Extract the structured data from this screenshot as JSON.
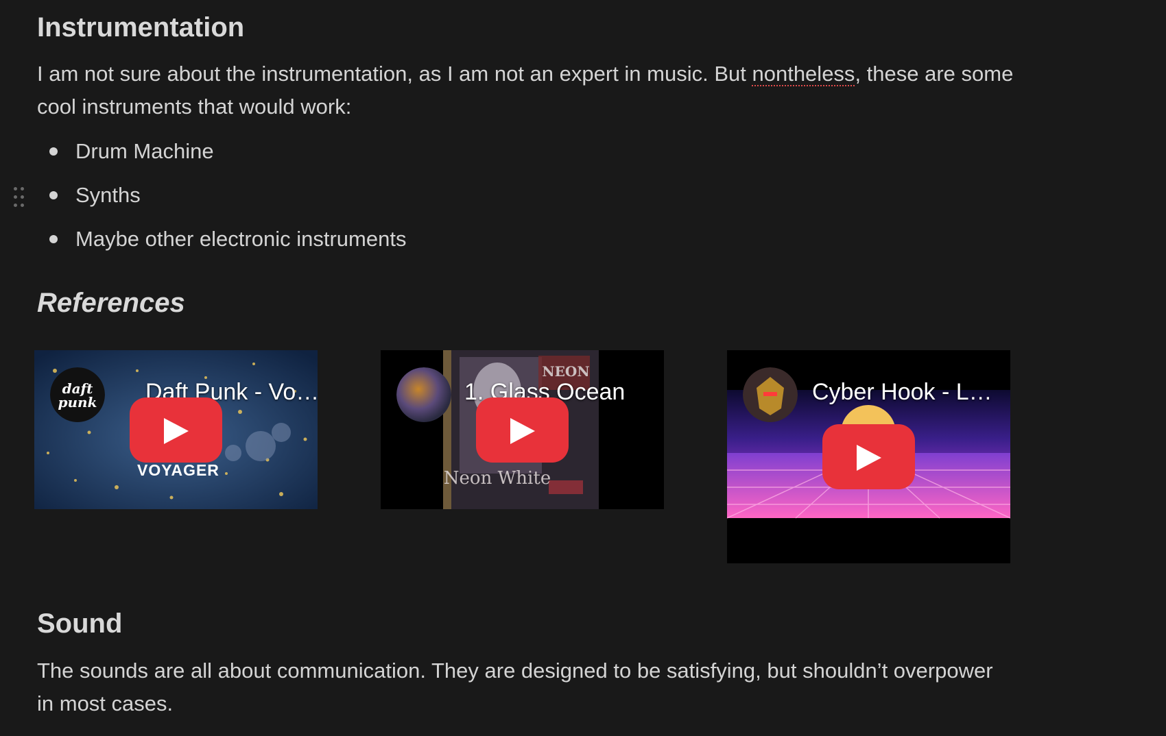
{
  "sections": {
    "instrumentation": {
      "heading": "Instrumentation",
      "para_before": "I am not sure about the instrumentation, as I am not an expert in music. But ",
      "para_misspelled": "nontheless",
      "para_after": ", these are some cool instruments that would work:",
      "bullets": [
        "Drum Machine",
        "Synths",
        "Maybe other electronic instruments"
      ]
    },
    "references": {
      "heading": "References",
      "videos": [
        {
          "title": "Daft Punk - Vo…",
          "overlay_text": "VOYAGER",
          "avatar_text": "daft punk",
          "thumb_colors": [
            "#1b3356",
            "#c9a33a"
          ]
        },
        {
          "title": "1. Glass Ocean",
          "overlay_text": "",
          "thumb_colors": [
            "#000000",
            "#5a4a5a"
          ]
        },
        {
          "title": "Cyber Hook - L…",
          "overlay_text": "",
          "thumb_colors": [
            "#2a1f6a",
            "#ff5fb4"
          ]
        }
      ]
    },
    "sound": {
      "heading": "Sound",
      "para": "The sounds are all about communication. They are designed to be satisfying, but shouldn’t overpower in most cases."
    }
  },
  "colors": {
    "background": "#191919",
    "text": "#d4d4d4",
    "heading": "#d9d9d9",
    "play_button": "#e8323a",
    "spellcheck": "#e04b4b"
  },
  "icons": {
    "drag_handle": "drag-handle-icon",
    "play": "play-icon"
  }
}
